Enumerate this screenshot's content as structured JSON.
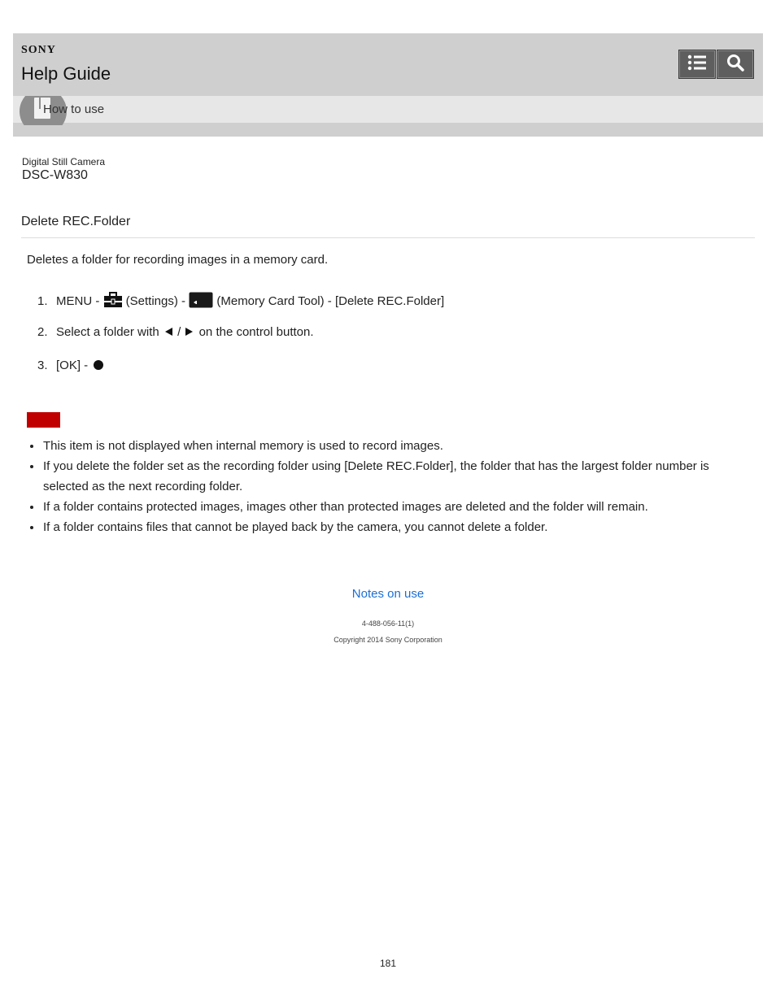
{
  "header": {
    "brand": "SONY",
    "title": "Help Guide",
    "section": "How to use"
  },
  "product": {
    "category": "Digital Still Camera",
    "model": "DSC-W830"
  },
  "page": {
    "title": "Delete REC.Folder",
    "intro": "Deletes a folder for recording images in a memory card."
  },
  "steps": [
    {
      "num": "1.",
      "p1": "MENU - ",
      "p2": " (Settings) - ",
      "p3": " (Memory Card Tool) - [Delete REC.Folder]"
    },
    {
      "num": "2.",
      "p1": "Select a folder with ",
      "p2": " / ",
      "p3": " on the control button."
    },
    {
      "num": "3.",
      "p1": "[OK] - "
    }
  ],
  "notes": [
    "This item is not displayed when internal memory is used to record images.",
    "If you delete the folder set as the recording folder using [Delete REC.Folder], the folder that has the largest folder number is selected as the next recording folder.",
    "If a folder contains protected images, images other than protected images are deleted and the folder will remain.",
    "If a folder contains files that cannot be played back by the camera, you cannot delete a folder."
  ],
  "footer": {
    "link": "Notes on use",
    "doc_number": "4-488-056-11(1)",
    "copyright": "Copyright 2014 Sony Corporation",
    "page_number": "181"
  },
  "colors": {
    "header_bg": "#cfcfcf",
    "note_badge": "#c00000",
    "link": "#1a6fd6"
  }
}
